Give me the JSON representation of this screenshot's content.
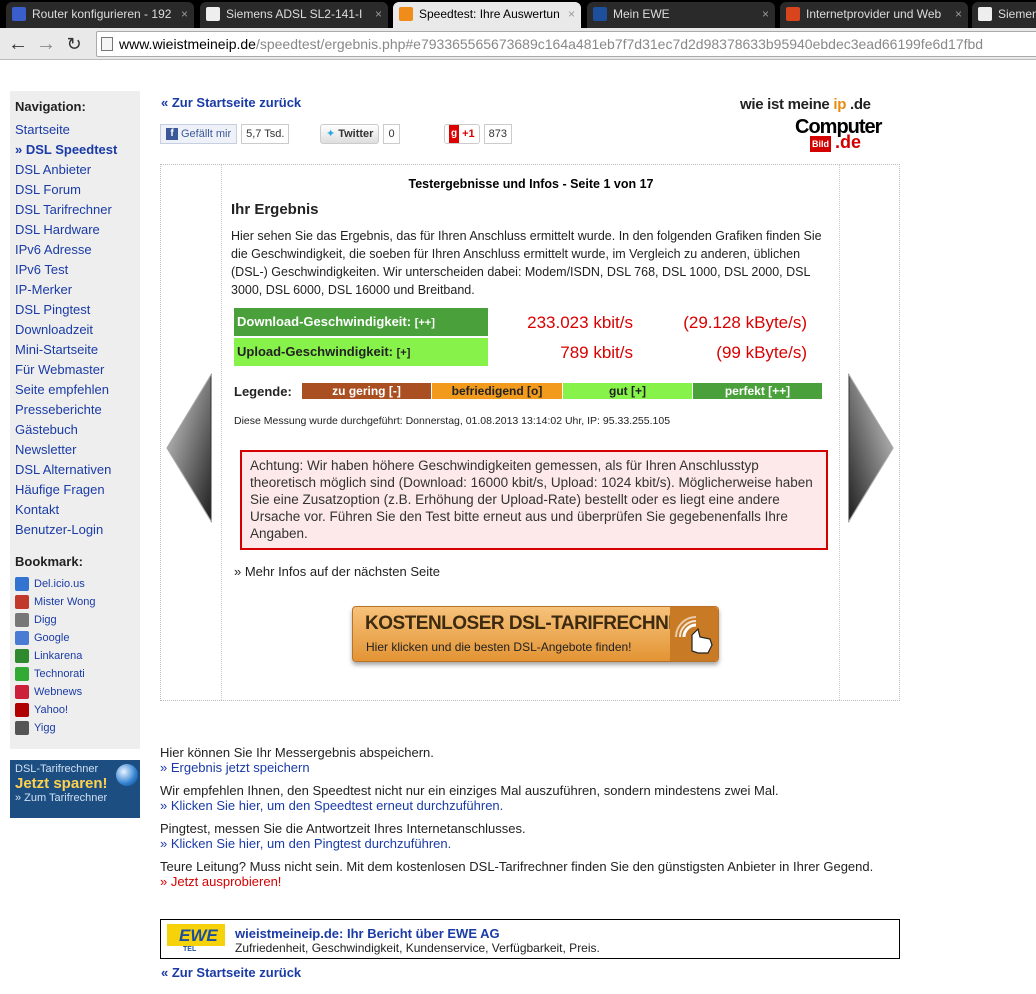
{
  "browser": {
    "tabs": [
      {
        "title": "Router konfigurieren - 192",
        "active": false,
        "color": "#3a5fcd"
      },
      {
        "title": "Siemens ADSL SL2-141-I",
        "active": false,
        "color": "#eeeeee"
      },
      {
        "title": "Speedtest: Ihre Auswertun",
        "active": true,
        "color": "#f08c1a"
      },
      {
        "title": "Mein EWE",
        "active": false,
        "color": "#1e4f9c"
      },
      {
        "title": "Internetprovider und Web",
        "active": false,
        "color": "#d8441c"
      },
      {
        "title": "Siemens",
        "active": false,
        "color": "#eeeeee"
      }
    ],
    "url_host": "www.wieistmeineip.de",
    "url_rest": "/speedtest/ergebnis.php#e793365565673689c164a481eb7f7d31ec7d2d98378633b95940ebdec3ead66199fe6d17fbd"
  },
  "sidebar": {
    "nav_heading": "Navigation:",
    "nav": [
      {
        "label": "Startseite",
        "current": false
      },
      {
        "label": "» DSL Speedtest",
        "current": true
      },
      {
        "label": "DSL Anbieter",
        "current": false
      },
      {
        "label": "DSL Forum",
        "current": false
      },
      {
        "label": "DSL Tarifrechner",
        "current": false
      },
      {
        "label": "DSL Hardware",
        "current": false
      },
      {
        "label": "IPv6 Adresse",
        "current": false
      },
      {
        "label": "IPv6 Test",
        "current": false
      },
      {
        "label": "IP-Merker",
        "current": false
      },
      {
        "label": "DSL Pingtest",
        "current": false
      },
      {
        "label": "Downloadzeit",
        "current": false
      },
      {
        "label": "Mini-Startseite",
        "current": false
      },
      {
        "label": "Für Webmaster",
        "current": false
      },
      {
        "label": "Seite empfehlen",
        "current": false
      },
      {
        "label": "Presseberichte",
        "current": false
      },
      {
        "label": "Gästebuch",
        "current": false
      },
      {
        "label": "Newsletter",
        "current": false
      },
      {
        "label": "DSL Alternativen",
        "current": false
      },
      {
        "label": "Häufige Fragen",
        "current": false
      },
      {
        "label": "Kontakt",
        "current": false
      },
      {
        "label": "Benutzer-Login",
        "current": false
      }
    ],
    "bookmark_heading": "Bookmark:",
    "bookmarks": [
      {
        "label": "Del.icio.us",
        "icon": "delicious-icon",
        "color": "#3274d0"
      },
      {
        "label": "Mister Wong",
        "icon": "misterwong-icon",
        "color": "#c0392b"
      },
      {
        "label": "Digg",
        "icon": "digg-icon",
        "color": "#777777"
      },
      {
        "label": "Google",
        "icon": "google-icon",
        "color": "#4a7bd4"
      },
      {
        "label": "Linkarena",
        "icon": "linkarena-icon",
        "color": "#2f8a2f"
      },
      {
        "label": "Technorati",
        "icon": "technorati-icon",
        "color": "#33aa33"
      },
      {
        "label": "Webnews",
        "icon": "webnews-icon",
        "color": "#cc1f3a"
      },
      {
        "label": "Yahoo!",
        "icon": "yahoo-icon",
        "color": "#b00000"
      },
      {
        "label": "Yigg",
        "icon": "yigg-icon",
        "color": "#555555"
      }
    ],
    "promo": {
      "line1": "DSL-Tarifrechner",
      "line2": "Jetzt sparen!",
      "line3": "» Zum Tarifrechner"
    }
  },
  "header": {
    "back_link": "« Zur Startseite zurück",
    "facebook_label": "Gefällt mir",
    "facebook_count": "5,7 Tsd.",
    "twitter_label": "Twitter",
    "twitter_count": "0",
    "gplus_label": "+1",
    "gplus_count": "873",
    "logo_text_a": "wie ist meine ",
    "logo_text_ip": "ip",
    "logo_text_b": " .de",
    "logo_cb": "Computer",
    "logo_bild": "Bild",
    "logo_de": ".de"
  },
  "result": {
    "page_title": "Testergebnisse und Infos - Seite 1 von 17",
    "heading": "Ihr Ergebnis",
    "intro": "Hier sehen Sie das Ergebnis, das für Ihren Anschluss ermittelt wurde. In den folgenden Grafiken finden Sie die Geschwindigkeit, die soeben für Ihren Anschluss ermittelt wurde, im Vergleich zu anderen, üblichen (DSL-) Geschwindigkeiten. Wir unterscheiden dabei: Modem/ISDN, DSL 768, DSL 1000, DSL 2000, DSL 3000, DSL 6000, DSL 16000 und Breitband.",
    "download_label": "Download-Geschwindigkeit:",
    "download_rating": "[++]",
    "download_kbit": "233.023 kbit/s",
    "download_kbyte": "(29.128 kByte/s)",
    "upload_label": "Upload-Geschwindigkeit:",
    "upload_rating": "[+]",
    "upload_kbit": "789 kbit/s",
    "upload_kbyte": "(99 kByte/s)",
    "legend_heading": "Legende:",
    "legend": [
      {
        "label": "zu gering [-]",
        "bg": "#a94f22",
        "fg": "#ffffff"
      },
      {
        "label": "befriedigend [o]",
        "bg": "#f29a1b",
        "fg": "#222222"
      },
      {
        "label": "gut [+]",
        "bg": "#86f24a",
        "fg": "#222222"
      },
      {
        "label": "perfekt [++]",
        "bg": "#4aa13b",
        "fg": "#ffffff"
      }
    ],
    "meta": "Diese Messung wurde durchgeführt: Donnerstag, 01.08.2013 13:14:02 Uhr, IP: 95.33.255.105",
    "warning": "Achtung: Wir haben höhere Geschwindigkeiten gemessen, als für Ihren Anschlusstyp theoretisch möglich sind (Download: 16000 kbit/s, Upload: 1024 kbit/s). Möglicherweise haben Sie eine Zusatzoption (z.B. Erhöhung der Upload-Rate) bestellt oder es liegt eine andere Ursache vor. Führen Sie den Test bitte erneut aus und überprüfen Sie gegebenenfalls Ihre Angaben.",
    "more_link": "» Mehr Infos auf der nächsten Seite",
    "banner_title": "KOSTENLOSER DSL-TARIFRECHNER",
    "banner_sub": "Hier klicken und die besten DSL-Angebote finden!"
  },
  "bottom": {
    "save_text": "Hier können Sie Ihr Messergebnis abspeichern.",
    "save_link": "» Ergebnis jetzt speichern",
    "repeat_text": "Wir empfehlen Ihnen, den Speedtest nicht nur ein einziges Mal auszuführen, sondern mindestens zwei Mal.",
    "repeat_link": "» Klicken Sie hier, um den Speedtest erneut durchzuführen.",
    "ping_text": "Pingtest, messen Sie die Antwortzeit Ihres Internetanschlusses.",
    "ping_link": "» Klicken Sie hier, um den Pingtest durchzuführen.",
    "tarif_text": "Teure Leitung? Muss nicht sein. Mit dem kostenlosen DSL-Tarifrechner finden Sie den günstigsten Anbieter in Ihrer Gegend.",
    "tarif_link": "» Jetzt ausprobieren!",
    "ewe_title": "wieistmeineip.de: Ihr Bericht über EWE AG",
    "ewe_sub": "Zufriedenheit, Geschwindigkeit, Kundenservice, Verfügbarkeit, Preis.",
    "ewe_logo": "EWE",
    "ewe_logo_sub": "TEL",
    "back_link": "« Zur Startseite zurück"
  }
}
